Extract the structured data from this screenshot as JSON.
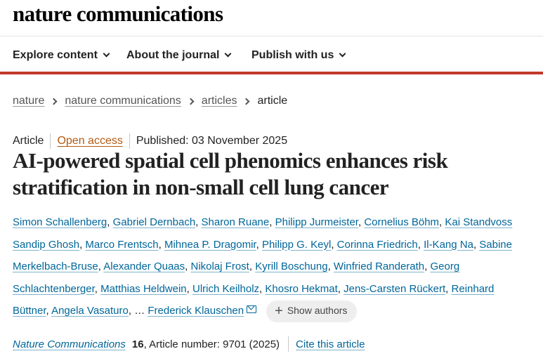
{
  "site": {
    "logo": "nature communications"
  },
  "nav": [
    {
      "label": "Explore content"
    },
    {
      "label": "About the journal"
    },
    {
      "label": "Publish with us"
    }
  ],
  "breadcrumb": [
    "nature",
    "nature communications",
    "articles",
    "article"
  ],
  "meta": {
    "type": "Article",
    "access": "Open access",
    "published": "Published: 03 November 2025"
  },
  "title": "AI-powered spatial cell phenomics enhances risk stratification in non-small cell lung cancer",
  "authors": [
    "Simon Schallenberg",
    "Gabriel Dernbach",
    "Sharon Ruane",
    "Philipp Jurmeister",
    "Cornelius Böhm",
    "Kai Standvoss",
    "Sandip Ghosh",
    "Marco Frentsch",
    "Mihnea P. Dragomir",
    "Philipp G. Keyl",
    "Corinna Friedrich",
    "Il-Kang Na",
    "Sabine",
    "Merkelbach-Bruse",
    "Alexander Quaas",
    "Nikolaj Frost",
    "Kyrill Boschung",
    "Winfried Randerath",
    "Georg",
    "Schlachtenberger",
    "Matthias Heldwein",
    "Ulrich Keilholz",
    "Khosro Hekmat",
    "Jens-Carsten Rückert",
    "Reinhard",
    "Büttner",
    "Angela Vasaturo"
  ],
  "authors_ellipsis": "…",
  "corresponding_author": "Frederick Klauschen",
  "show_authors_label": "Show authors",
  "citation": {
    "journal": "Nature Communications",
    "volume": "16",
    "article_number": ", Article number: 9701 (2025)",
    "cite_link": "Cite this article"
  }
}
